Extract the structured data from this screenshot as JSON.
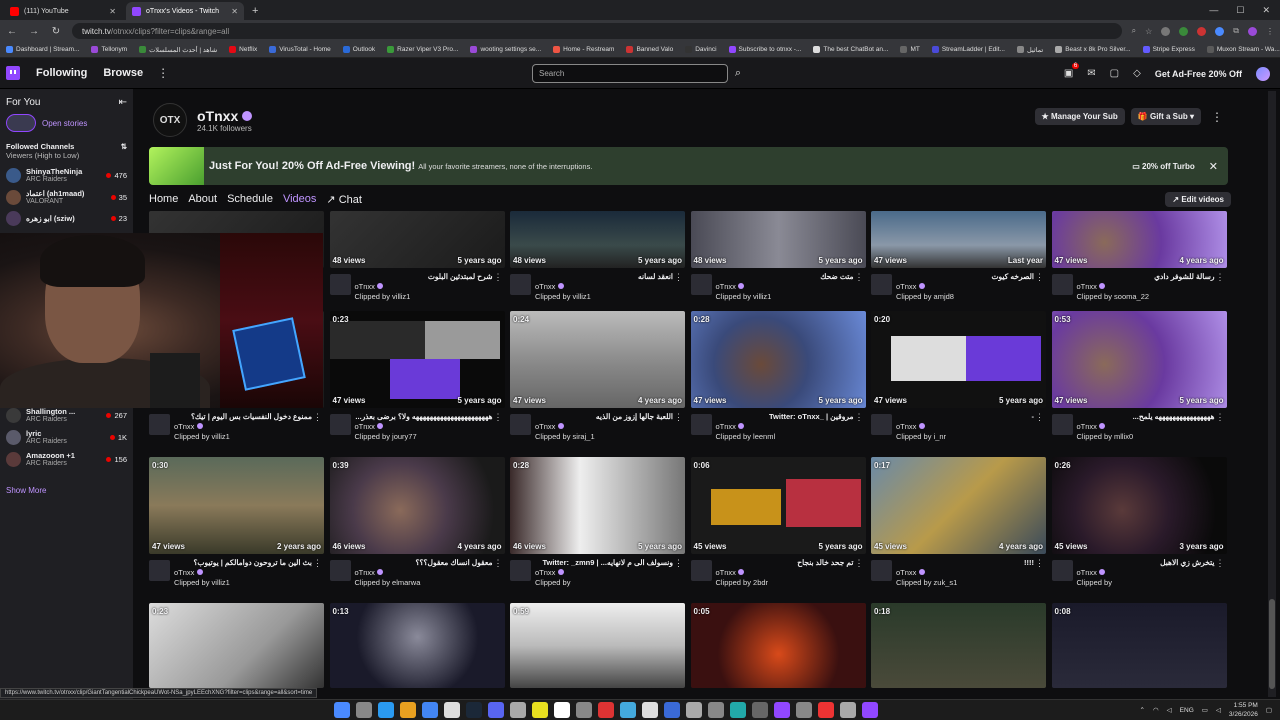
{
  "browser": {
    "tabs": [
      {
        "title": "(111) YouTube",
        "color": "#ff0000"
      },
      {
        "title": "oTnxx's Videos - Twitch",
        "color": "#9147ff"
      }
    ],
    "url_host": "twitch.tv",
    "url_path": "/otnxx/clips?filter=clips&range=all",
    "bookmarks": [
      "Dashboard | Stream...",
      "Tellonym",
      "شاهد | أحدث المسلسلات",
      "Netflix",
      "VirusTotal - Home",
      "Outlook",
      "Razer Viper V3 Pro...",
      "wooting settings se...",
      "Home - Restream",
      "Banned Valo",
      "Davinci",
      "Subscribe to otnxx -...",
      "The best ChatBot an...",
      "MT",
      "StreamLadder | Edit...",
      "تماثيل",
      "Beast x 8k Pro Silver...",
      "Stripe Express",
      "Muxon Stream - Wa..."
    ]
  },
  "topnav": {
    "following": "Following",
    "browse": "Browse",
    "search_placeholder": "Search",
    "notif_count": "6",
    "turbo": "Get Ad-Free 20% Off"
  },
  "sidebar": {
    "for_you": "For You",
    "open_stories": "Open stories",
    "followed_title": "Followed Channels",
    "followed_sort": "Viewers (High to Low)",
    "channels": [
      {
        "name": "ShinyaTheNinja",
        "game": "ARC Raiders",
        "viewers": "476",
        "color": "#3a5a8a"
      },
      {
        "name": "اعتماد (ah1maad)",
        "game": "VALORANT",
        "viewers": "35",
        "color": "#6a4a3a"
      },
      {
        "name": "ابو زهره (sziw)",
        "game": "",
        "viewers": "23",
        "color": "#4a3a5a"
      }
    ],
    "channels_bottom": [
      {
        "name": "Shallington ...",
        "game": "ARC Raiders",
        "viewers": "267",
        "color": "#3a3a3a"
      },
      {
        "name": "lyric",
        "game": "ARC Raiders",
        "viewers": "1K",
        "color": "#5a5a6a"
      },
      {
        "name": "Amazooon +1",
        "game": "ARC Raiders",
        "viewers": "156",
        "color": "#5a3a3a"
      }
    ],
    "show_more": "Show More"
  },
  "profile": {
    "logo_text": "OTX",
    "name": "oTnxx",
    "followers": "24.1K followers",
    "manage_sub": "Manage Your Sub",
    "gift_sub": "Gift a Sub"
  },
  "banner": {
    "title": "Just For You! 20% Off Ad-Free Viewing!",
    "sub": "All your favorite streamers, none of the interruptions.",
    "turbo": "20% off Turbo"
  },
  "tabs": [
    "Home",
    "About",
    "Schedule",
    "Videos",
    "Chat"
  ],
  "edit_videos": "Edit videos",
  "clips": [
    {
      "dur": "",
      "views": "",
      "ago": "",
      "title": "",
      "channel": "",
      "by": "",
      "thumb": "t-grey"
    },
    {
      "dur": "",
      "views": "48 views",
      "ago": "5 years ago",
      "title": "شرح لمبتدئين البلوت",
      "channel": "oTnxx",
      "by": "Clipped by villiz1",
      "thumb": "t-grey"
    },
    {
      "dur": "",
      "views": "48 views",
      "ago": "5 years ago",
      "title": "انعقد لسانه",
      "channel": "oTnxx",
      "by": "Clipped by villiz1",
      "thumb": "t-city"
    },
    {
      "dur": "",
      "views": "48 views",
      "ago": "5 years ago",
      "title": "متت ضحك",
      "channel": "oTnxx",
      "by": "Clipped by villiz1",
      "thumb": "t-hall"
    },
    {
      "dur": "",
      "views": "47 views",
      "ago": "Last year",
      "title": "الصرخه كيوت",
      "channel": "oTnxx",
      "by": "Clipped by amjd8",
      "thumb": "t-fps"
    },
    {
      "dur": "",
      "views": "47 views",
      "ago": "4 years ago",
      "title": "رسالة للشوفر دادي",
      "channel": "oTnxx",
      "by": "Clipped by sooma_22",
      "thumb": "t-purple"
    },
    {
      "dur": "",
      "views": "",
      "ago": "",
      "title": "ممنوع دخول النفسيات بس اليوم | تيك؟",
      "channel": "oTnxx",
      "by": "Clipped by villiz1",
      "thumb": "t-grey"
    },
    {
      "dur": "0:23",
      "views": "47 views",
      "ago": "5 years ago",
      "title": "...ههههههههههههههههههههههه ولا؟ برضى بعذر",
      "channel": "oTnxx",
      "by": "Clipped by joury77",
      "thumb": "t-split"
    },
    {
      "dur": "0:24",
      "views": "47 views",
      "ago": "4 years ago",
      "title": "اللعبة جالها إزوز من الذيه",
      "channel": "oTnxx",
      "by": "Clipped by siraj_1",
      "thumb": "t-street"
    },
    {
      "dur": "0:28",
      "views": "47 views",
      "ago": "5 years ago",
      "title": "Twitter: oTnxx_ | مروقين",
      "channel": "oTnxx",
      "by": "Clipped by leenml",
      "thumb": "t-blue"
    },
    {
      "dur": "0:20",
      "views": "47 views",
      "ago": "5 years ago",
      "title": "-",
      "channel": "oTnxx",
      "by": "Clipped by i_nr",
      "thumb": "t-split2"
    },
    {
      "dur": "0:53",
      "views": "47 views",
      "ago": "5 years ago",
      "title": "...ههههههههههههههههه يلمح",
      "channel": "oTnxx",
      "by": "Clipped by mllix0",
      "thumb": "t-purple"
    },
    {
      "dur": "0:30",
      "views": "47 views",
      "ago": "2 years ago",
      "title": "بث الين ما تروحون دوامالكم | يوتيوب؟",
      "channel": "oTnxx",
      "by": "Clipped by villiz1",
      "thumb": "t-green"
    },
    {
      "dur": "0:39",
      "views": "46 views",
      "ago": "4 years ago",
      "title": "معقول انساك معقول؟؟؟",
      "channel": "oTnxx",
      "by": "Clipped by elmarwa",
      "thumb": "t-room"
    },
    {
      "dur": "0:28",
      "views": "46 views",
      "ago": "5 years ago",
      "title": "Twitter: _zmn9 | ...ونسولف الى م لانهايه",
      "channel": "oTnxx",
      "by": "Clipped by",
      "thumb": "t-collage"
    },
    {
      "dur": "0:06",
      "views": "45 views",
      "ago": "5 years ago",
      "title": "تم جحد خالد بنجاح",
      "channel": "oTnxx",
      "by": "Clipped by 2bdr",
      "thumb": "t-orange"
    },
    {
      "dur": "0:17",
      "views": "45 views",
      "ago": "4 years ago",
      "title": "!!!!",
      "channel": "oTnxx",
      "by": "Clipped by zuk_s1",
      "thumb": "t-crane"
    },
    {
      "dur": "0:26",
      "views": "45 views",
      "ago": "3 years ago",
      "title": "يتخرش زي الاهبل",
      "channel": "oTnxx",
      "by": "Clipped by",
      "thumb": "t-dark"
    },
    {
      "dur": "0:23",
      "views": "",
      "ago": "",
      "title": "",
      "channel": "",
      "by": "",
      "thumb": "t-white"
    },
    {
      "dur": "0:13",
      "views": "",
      "ago": "",
      "title": "",
      "channel": "",
      "by": "",
      "thumb": "t-ghoul"
    },
    {
      "dur": "0:59",
      "views": "",
      "ago": "",
      "title": "",
      "channel": "",
      "by": "",
      "thumb": "t-collage2"
    },
    {
      "dur": "0:05",
      "views": "",
      "ago": "",
      "title": "",
      "channel": "",
      "by": "",
      "thumb": "t-fire"
    },
    {
      "dur": "0:18",
      "views": "",
      "ago": "",
      "title": "",
      "channel": "",
      "by": "",
      "thumb": "t-forest"
    },
    {
      "dur": "0:08",
      "views": "",
      "ago": "",
      "title": "",
      "channel": "",
      "by": "",
      "thumb": "t-night"
    }
  ],
  "status_url": "https://www.twitch.tv/otnxx/clip/GiantTangentialChickpeaUWot-NSa_jpyLEEchXNG?filter=clips&range=all&sort=time",
  "taskbar": {
    "lang": "ENG",
    "time": "1:55 PM",
    "date": "3/26/2026"
  }
}
